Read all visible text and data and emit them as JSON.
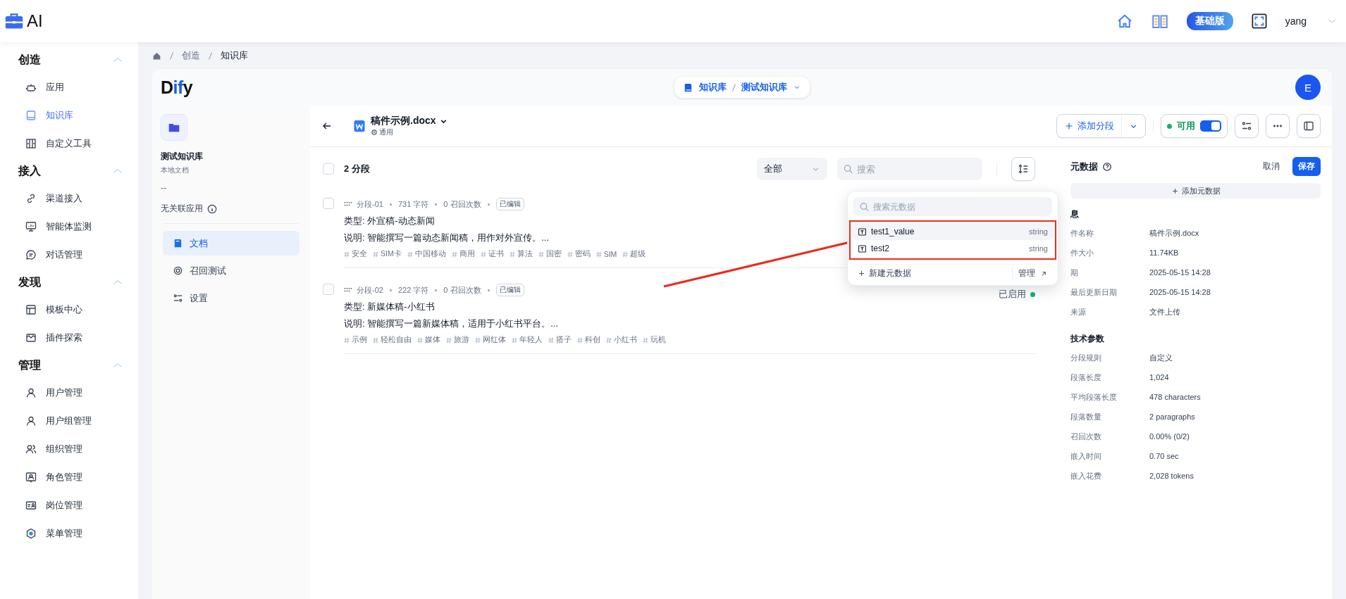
{
  "topbar": {
    "logo_text": "AI",
    "plan_badge": "基础版",
    "user": "yang"
  },
  "sidebar": {
    "groups": [
      {
        "title": "创造",
        "expanded": true,
        "items": [
          {
            "label": "应用",
            "selected": false
          },
          {
            "label": "知识库",
            "selected": true
          },
          {
            "label": "自定义工具",
            "selected": false
          }
        ]
      },
      {
        "title": "接入",
        "expanded": true,
        "items": [
          {
            "label": "渠道接入",
            "selected": false
          },
          {
            "label": "智能体监测",
            "selected": false
          },
          {
            "label": "对话管理",
            "selected": false
          }
        ]
      },
      {
        "title": "发现",
        "expanded": true,
        "items": [
          {
            "label": "模板中心",
            "selected": false
          },
          {
            "label": "插件探索",
            "selected": false
          }
        ]
      },
      {
        "title": "管理",
        "expanded": true,
        "items": [
          {
            "label": "用户管理",
            "selected": false
          },
          {
            "label": "用户组管理",
            "selected": false
          },
          {
            "label": "组织管理",
            "selected": false
          },
          {
            "label": "角色管理",
            "selected": false
          },
          {
            "label": "岗位管理",
            "selected": false
          },
          {
            "label": "菜单管理",
            "selected": false
          }
        ]
      }
    ]
  },
  "breadcrumb": [
    "创造",
    "知识库"
  ],
  "header": {
    "logo": "Dify",
    "nav": [
      "知识库",
      "测试知识库"
    ],
    "avatar": "E"
  },
  "dataset": {
    "name": "测试知识库",
    "type": "本地文档",
    "description": "--",
    "linked_apps": "无关联应用",
    "nav": [
      {
        "label": "文档",
        "selected": true
      },
      {
        "label": "召回测试",
        "selected": false
      },
      {
        "label": "设置",
        "selected": false
      }
    ]
  },
  "document": {
    "title": "稿件示例.docx",
    "mode": "通用",
    "add_segment": "添加分段",
    "status": "可用",
    "enabled": true
  },
  "segments": {
    "select_all_checked": false,
    "count": "2 分段",
    "filter": "全部",
    "search_placeholder": "搜索",
    "items": [
      {
        "checked": false,
        "id": "分段-01",
        "chars": "731 字符",
        "hits": "0 召回次数",
        "badge": "已编辑",
        "type_line": "类型: 外宣稿-动态新闻",
        "desc": "说明: 智能撰写一篇动态新闻稿，用作对外宣传。...",
        "keywords": [
          "安全",
          "SIM卡",
          "中国移动",
          "商用",
          "证书",
          "算法",
          "国密",
          "密码",
          "SIM",
          "超级"
        ]
      },
      {
        "checked": false,
        "id": "分段-02",
        "chars": "222 字符",
        "hits": "0 召回次数",
        "badge": "已编辑",
        "status": "已启用",
        "type_line": "类型: 新媒体稿-小红书",
        "desc": "说明: 智能撰写一篇新媒体稿，适用于小红书平台。...",
        "keywords": [
          "示例",
          "轻松自由",
          "媒体",
          "旅游",
          "网红体",
          "年轻人",
          "搭子",
          "科创",
          "小红书",
          "玩机"
        ]
      }
    ]
  },
  "metadata": {
    "title": "元数据",
    "cancel": "取消",
    "save": "保存",
    "add": "添加元数据",
    "basic_heading": "息",
    "basic_info": [
      {
        "label": "件名称",
        "value": "稿件示例.docx"
      },
      {
        "label": "件大小",
        "value": "11.74KB"
      },
      {
        "label": "期",
        "value": "2025-05-15 14:28"
      },
      {
        "label": "最后更新日期",
        "value": "2025-05-15 14:28"
      },
      {
        "label": "来源",
        "value": "文件上传"
      }
    ],
    "tech_heading": "技术参数",
    "tech": [
      {
        "label": "分段规则",
        "value": "自定义"
      },
      {
        "label": "段落长度",
        "value": "1,024"
      },
      {
        "label": "平均段落长度",
        "value": "478 characters"
      },
      {
        "label": "段落数量",
        "value": "2 paragraphs"
      },
      {
        "label": "召回次数",
        "value": "0.00% (0/2)"
      },
      {
        "label": "嵌入时间",
        "value": "0.70 sec"
      },
      {
        "label": "嵌入花费",
        "value": "2,028 tokens"
      }
    ]
  },
  "metadata_popup": {
    "search_placeholder": "搜索元数据",
    "items": [
      {
        "name": "test1_value",
        "type": "string",
        "selected": true
      },
      {
        "name": "test2",
        "type": "string",
        "selected": false
      }
    ],
    "new": "新建元数据",
    "manage": "管理"
  }
}
